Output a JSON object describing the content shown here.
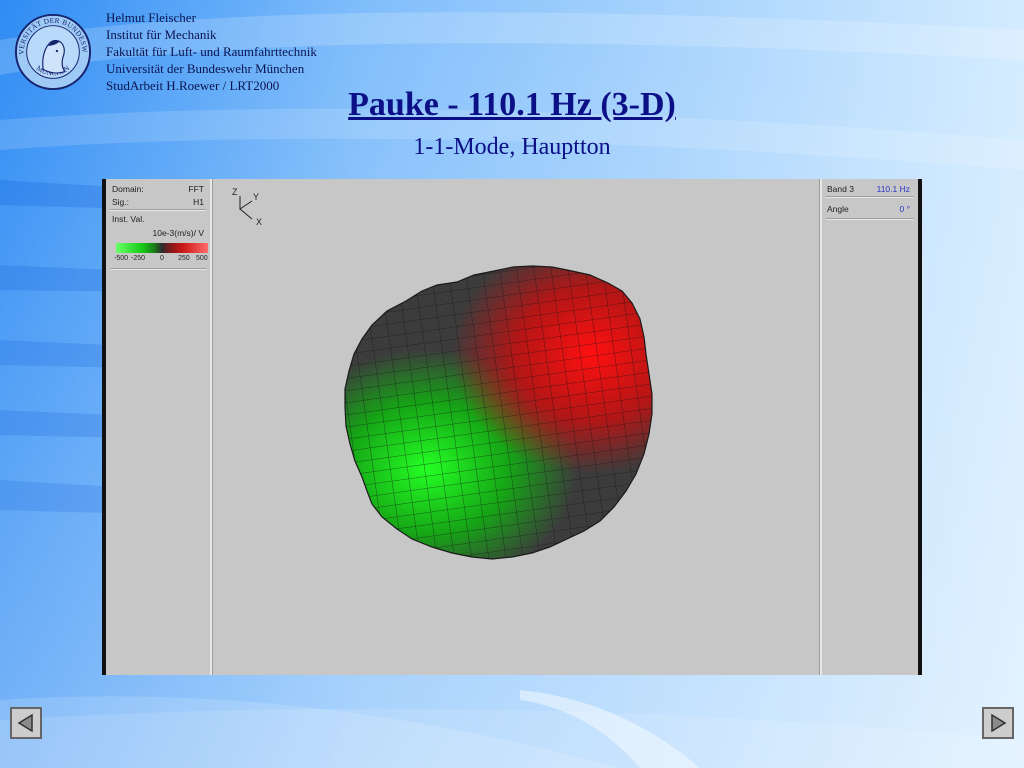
{
  "logo": {
    "text_top": "UNIVERSITÄT DER BUNDESWEHR",
    "text_bottom": "MÜNCHEN"
  },
  "author": {
    "lines": [
      "Helmut Fleischer",
      "Institut für Mechanik",
      "Fakultät für Luft- und Raumfahrttechnik",
      "Universität der Bundeswehr München",
      "StudArbeit H.Roewer / LRT2000"
    ]
  },
  "slide": {
    "title": "Pauke - 110.1 Hz (3-D)",
    "subtitle": "1-1-Mode, Hauptton"
  },
  "left_panel": {
    "domain_label": "Domain:",
    "domain_value": "FFT",
    "sig_label": "Sig.:",
    "sig_value": "H1",
    "inst_label": "Inst. Val.",
    "units": "10e-3(m/s)/ V",
    "scale_ticks": [
      "-500",
      "-250",
      "0",
      "250",
      "500"
    ]
  },
  "right_panel": {
    "band_label": "Band 3",
    "band_value": "110.1 Hz",
    "angle_label": "Angle",
    "angle_value": "0 °"
  },
  "axes": {
    "z": "Z",
    "y": "Y",
    "x": "X"
  },
  "colors": {
    "positive": "#e01010",
    "negative": "#10d010",
    "neutral": "#3c3c3c",
    "title": "#0c0f86"
  },
  "icons": {
    "prev": "triangle-left-icon",
    "next": "triangle-right-icon"
  }
}
